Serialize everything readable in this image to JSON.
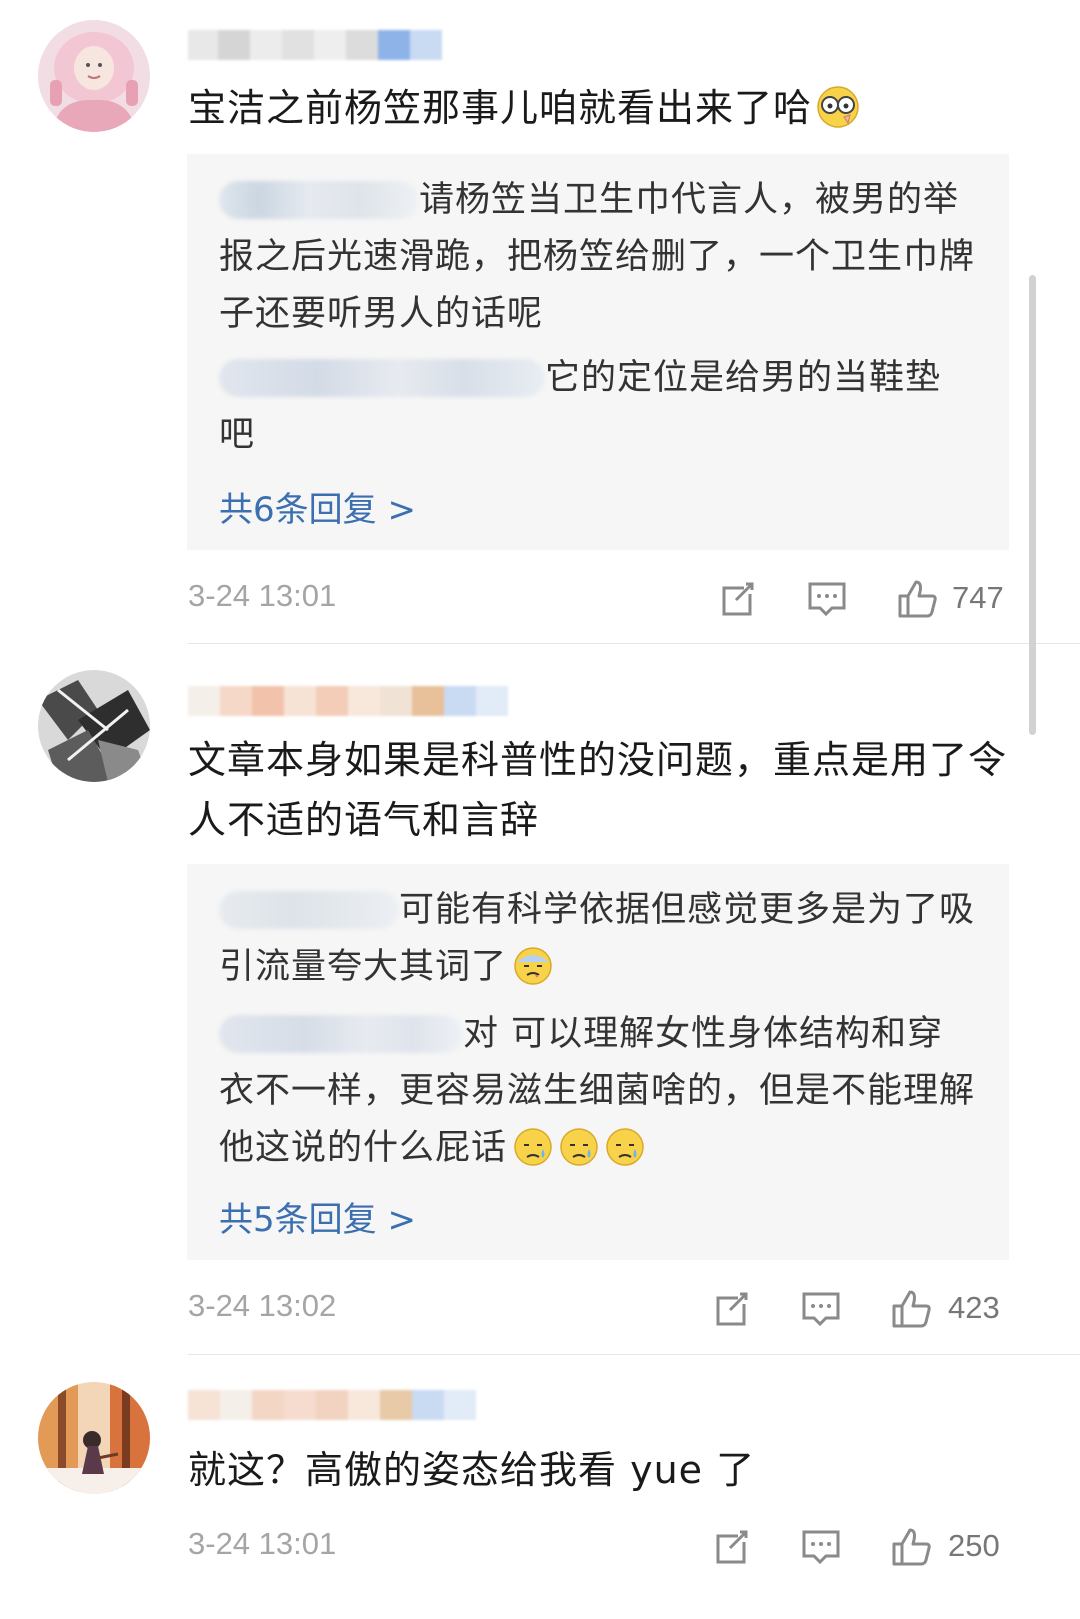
{
  "comments": [
    {
      "text": "宝洁之前杨笠那事儿咱就看出来了哈",
      "emoji": "glasses-face-emoji",
      "replies": [
        {
          "text": "请杨笠当卫生巾代言人，被男的举报之后光速滑跪，把杨笠给删了，一个卫生巾牌子还要听男人的话呢"
        },
        {
          "text": "它的定位是给男的当鞋垫吧"
        }
      ],
      "reply_count": "共6条回复 >",
      "time": "3-24 13:01",
      "likes": "747"
    },
    {
      "text": "文章本身如果是科普性的没问题，重点是用了令人不适的语气和言辞",
      "replies": [
        {
          "text": "可能有科学依据但感觉更多是为了吸引流量夸大其词了",
          "emoji": "sweat-face-emoji"
        },
        {
          "text": "对 可以理解女性身体结构和穿衣不一样，更容易滋生细菌啥的，但是不能理解他这说的什么屁话",
          "emoji": "sad-face-emoji"
        }
      ],
      "reply_count": "共5条回复 >",
      "time": "3-24 13:02",
      "likes": "423"
    },
    {
      "text": "就这？高傲的姿态给我看 yue 了",
      "time": "3-24 13:01",
      "likes": "250"
    }
  ],
  "colors": {
    "link_blue": "#3c6fb0",
    "meta_gray": "#a5a5a5",
    "reply_bg": "#f6f6f6"
  }
}
